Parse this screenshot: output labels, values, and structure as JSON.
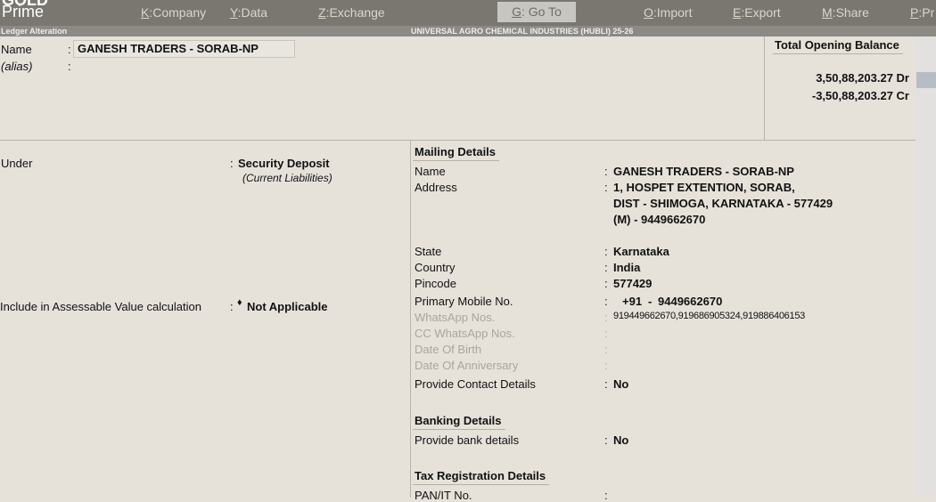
{
  "app": {
    "brand_top": "GOLD",
    "brand_bottom": "Prime"
  },
  "menu": [
    {
      "key": "K",
      "label": "Company"
    },
    {
      "key": "Y",
      "label": "Data"
    },
    {
      "key": "Z",
      "label": "Exchange"
    },
    {
      "key": "G",
      "label": "Go To"
    },
    {
      "key": "O",
      "label": "Import"
    },
    {
      "key": "E",
      "label": "Export"
    },
    {
      "key": "M",
      "label": "Share"
    },
    {
      "key": "P",
      "label": "Pr"
    }
  ],
  "subbar": {
    "screen": "Ledger Alteration",
    "company": "UNIVERSAL AGRO CHEMICAL INDUSTRIES (HUBLI)  25-26"
  },
  "ledger": {
    "name_label": "Name",
    "name_value": "GANESH TRADERS - SORAB-NP",
    "alias_label": "(alias)",
    "under_label": "Under",
    "under_value": "Security Deposit",
    "under_group": "(Current Liabilities)",
    "assess_label": "Include in Assessable Value calculation",
    "assess_value": "Not Applicable"
  },
  "opening": {
    "title": "Total Opening Balance",
    "dr": "3,50,88,203.27 Dr",
    "cr": "-3,50,88,203.27 Cr"
  },
  "mailing": {
    "title": "Mailing Details",
    "name_label": "Name",
    "name_value": "GANESH TRADERS - SORAB-NP",
    "address_label": "Address",
    "address_lines": [
      "1, HOSPET EXTENTION, SORAB,",
      "DIST - SHIMOGA, KARNATAKA - 577429",
      "(M) - 9449662670"
    ],
    "state_label": "State",
    "state_value": "Karnataka",
    "country_label": "Country",
    "country_value": "India",
    "pincode_label": "Pincode",
    "pincode_value": "577429",
    "mobile_label": "Primary Mobile No.",
    "mobile_code": "+91",
    "mobile_sep": "-",
    "mobile_value": "9449662670",
    "whatsapp_label": "WhatsApp Nos.",
    "whatsapp_value": "919449662670,919686905324,919886406153",
    "cc_whatsapp_label": "CC WhatsApp Nos.",
    "dob_label": "Date Of Birth",
    "doa_label": "Date Of Anniversary",
    "contact_label": "Provide Contact Details",
    "contact_value": "No"
  },
  "banking": {
    "title": "Banking Details",
    "bank_label": "Provide bank details",
    "bank_value": "No"
  },
  "tax": {
    "title": "Tax Registration Details",
    "pan_label": "PAN/IT No."
  },
  "colon": ":"
}
